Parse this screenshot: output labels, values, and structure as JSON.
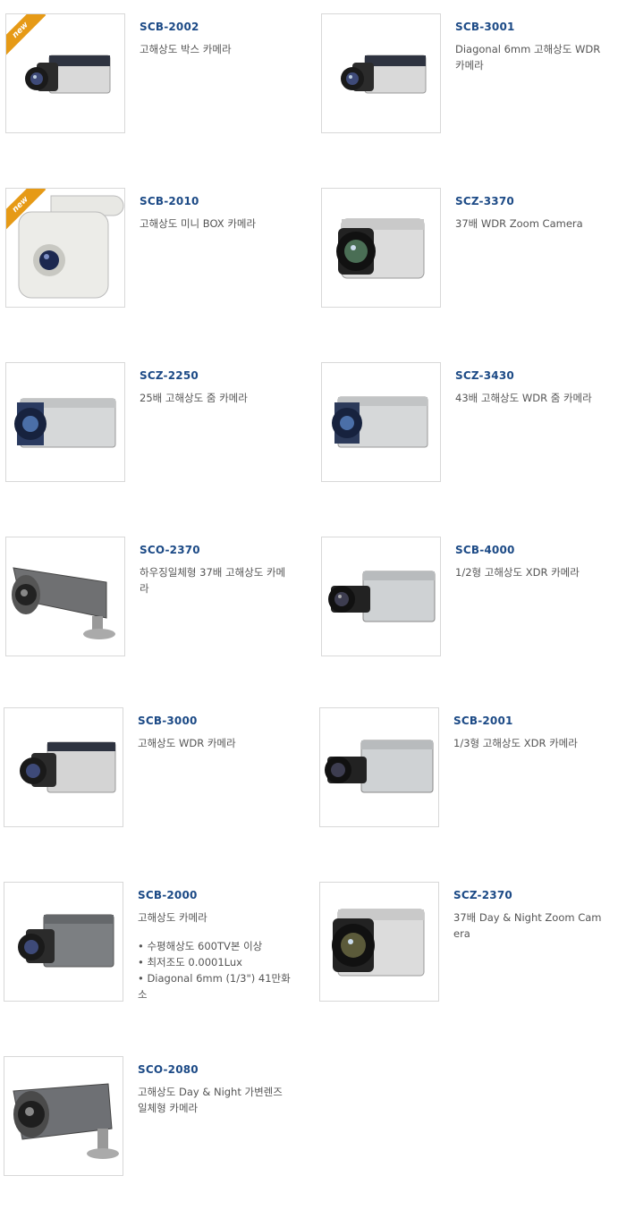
{
  "badge_label": "new",
  "colors": {
    "model": "#1c4a86",
    "text": "#555555",
    "badge": "#e69a16",
    "border": "#d8d8d8"
  },
  "products": [
    {
      "model": "SCB-2002",
      "desc": "고해상도 박스 카메라",
      "image": "box-camera-icon",
      "new": true
    },
    {
      "model": "SCB-3001",
      "desc": "Diagonal 6mm 고해상도 WDR 카메라",
      "image": "box-camera-icon",
      "new": false
    },
    {
      "model": "SCB-2010",
      "desc": "고해상도 미니 BOX 카메라",
      "image": "mini-box-camera-icon",
      "new": true
    },
    {
      "model": "SCZ-3370",
      "desc": "37배 WDR Zoom Camera",
      "image": "zoom-camera-icon",
      "new": false
    },
    {
      "model": "SCZ-2250",
      "desc": "25배 고해상도 줌 카메라",
      "image": "zoom-camera-icon",
      "new": false
    },
    {
      "model": "SCZ-3430",
      "desc": "43배 고해상도 WDR 줌 카메라",
      "image": "zoom-camera-icon",
      "new": false
    },
    {
      "model": "SCO-2370",
      "desc": "하우징일체형 37배 고해상도 카메라",
      "image": "bullet-camera-icon",
      "new": false
    },
    {
      "model": "SCB-4000",
      "desc": "1/2형 고해상도 XDR 카메라",
      "image": "box-camera-icon",
      "new": false
    },
    {
      "model": "SCB-3000",
      "desc": "고해상도 WDR 카메라",
      "image": "box-camera-icon",
      "new": false
    },
    {
      "model": "SCB-2001",
      "desc": "1/3형 고해상도 XDR 카메라",
      "image": "box-camera-icon",
      "new": false
    },
    {
      "model": "SCB-2000",
      "desc": "고해상도 카메라",
      "image": "box-camera-icon",
      "new": false,
      "features": [
        "수평해상도 600TV본 이상",
        "최저조도 0.0001Lux",
        "Diagonal 6mm (1/3\") 41만화소"
      ]
    },
    {
      "model": "SCZ-2370",
      "desc": "37배 Day & Night Zoom Camera",
      "image": "zoom-camera-icon",
      "new": false
    },
    {
      "model": "SCO-2080",
      "desc": "고해상도 Day & Night 가변렌즈 일체형 카메라",
      "image": "bullet-camera-icon",
      "new": false
    }
  ]
}
